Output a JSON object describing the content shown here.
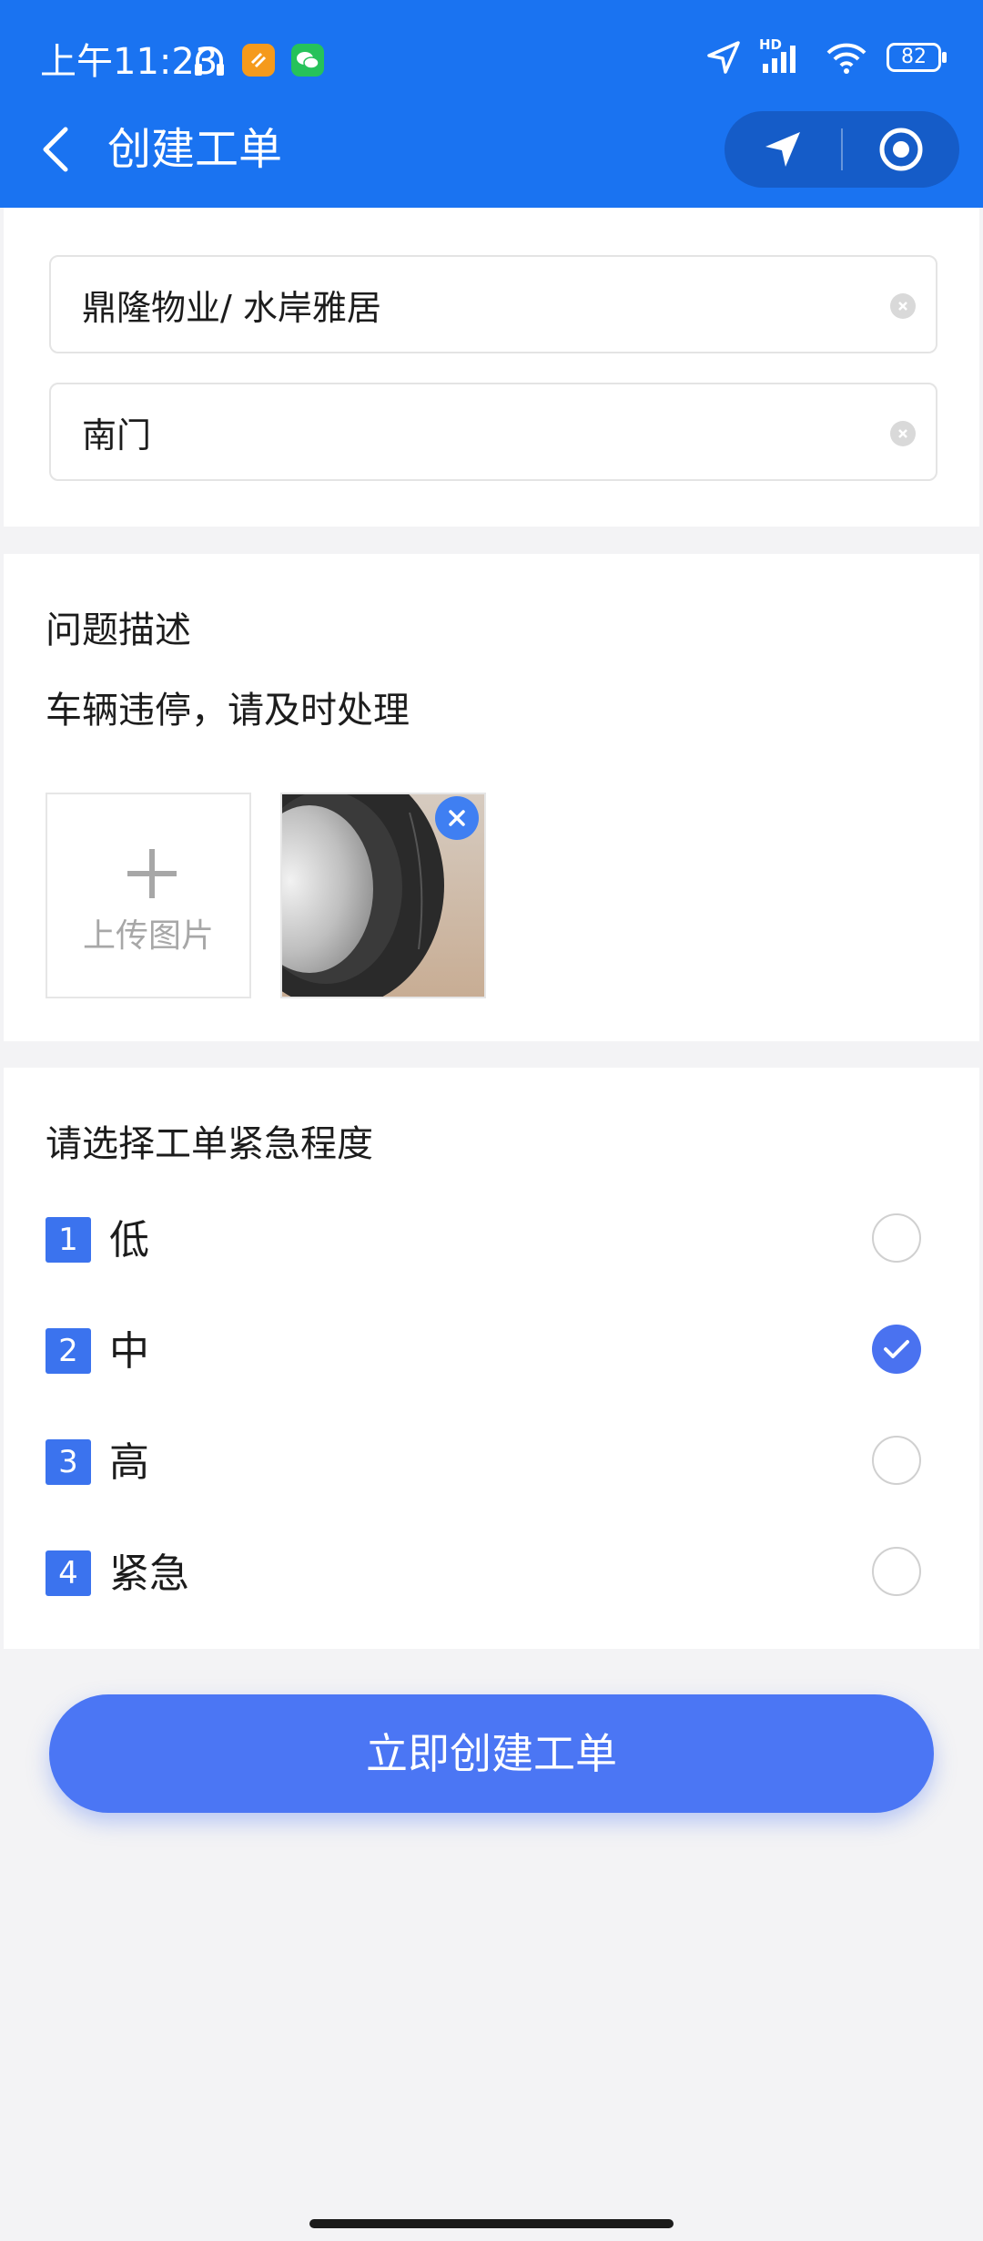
{
  "status_bar": {
    "time": "上午11:23",
    "network": "HD",
    "battery": "82"
  },
  "nav": {
    "title": "创建工单"
  },
  "location": {
    "community": "鼎隆物业/ 水岸雅居",
    "spot": "南门"
  },
  "problem": {
    "title": "问题描述",
    "text": "车辆违停，请及时处理",
    "upload_label": "上传图片"
  },
  "urgency": {
    "title": "请选择工单紧急程度",
    "options": [
      {
        "num": "1",
        "label": "低",
        "checked": false
      },
      {
        "num": "2",
        "label": "中",
        "checked": true
      },
      {
        "num": "3",
        "label": "高",
        "checked": false
      },
      {
        "num": "4",
        "label": "紧急",
        "checked": false
      }
    ]
  },
  "submit_label": "立即创建工单",
  "colors": {
    "header": "#1a73f1",
    "accent": "#4b76f4"
  }
}
